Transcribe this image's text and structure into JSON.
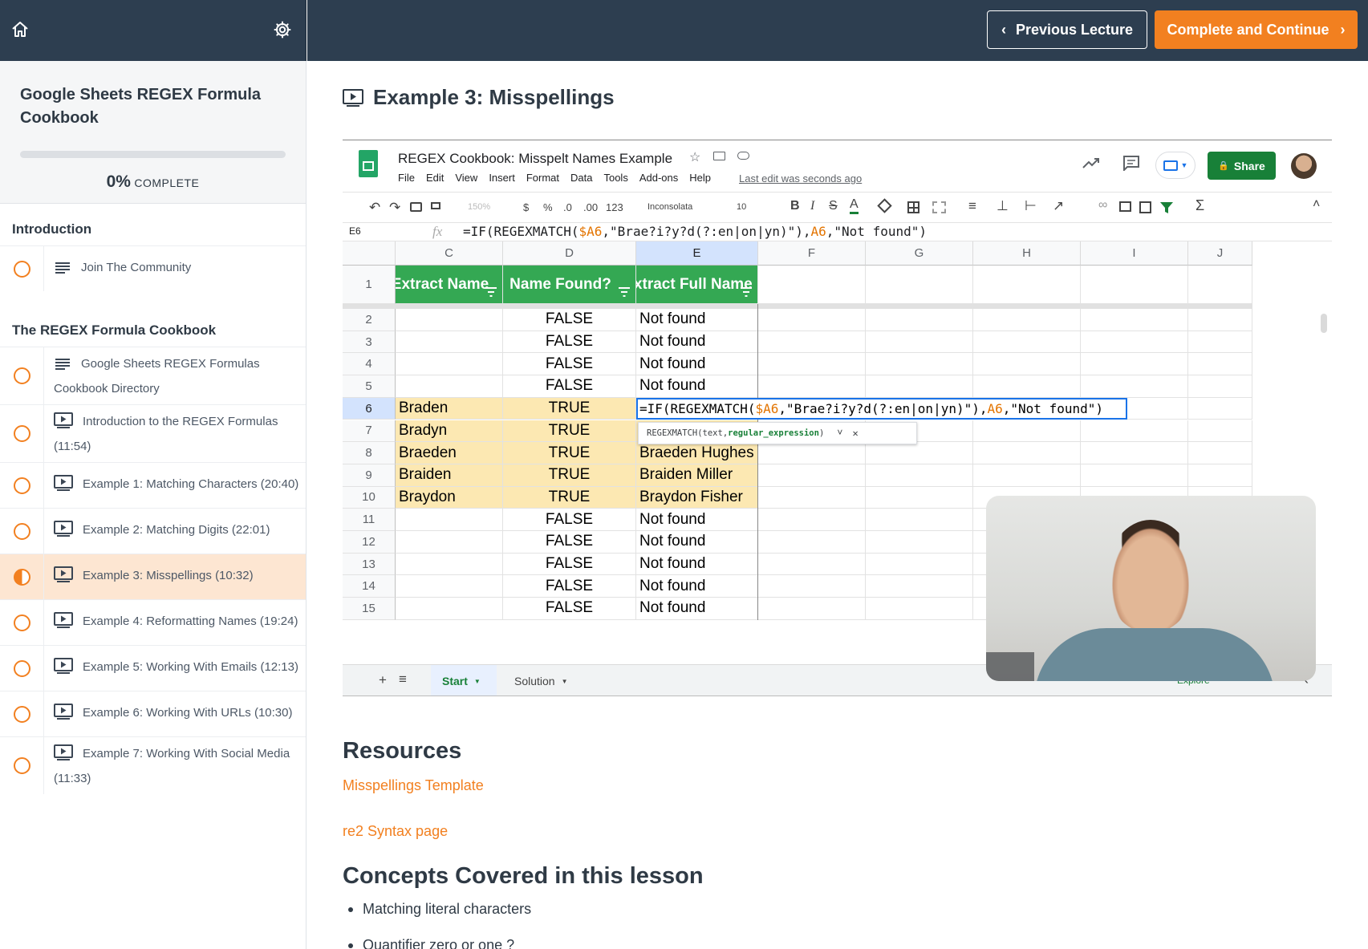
{
  "topbar": {
    "home_icon": "home-icon",
    "settings_icon": "gear-icon",
    "prev_label": "Previous Lecture",
    "next_label": "Complete and Continue",
    "accent": "#f28020",
    "bar_color": "#2d3e50"
  },
  "sidebar": {
    "course_title": "Google Sheets REGEX Formula Cookbook",
    "progress_percent": "0%",
    "progress_suffix": "COMPLETE",
    "progress_fraction": 0,
    "sections": [
      {
        "title": "Introduction",
        "items": [
          {
            "label": "Join The Community",
            "icon": "text-lines-icon",
            "status": "not-started"
          }
        ]
      },
      {
        "title": "The REGEX Formula Cookbook",
        "items": [
          {
            "label": "Google Sheets REGEX Formulas Cookbook Directory",
            "icon": "text-lines-icon",
            "status": "not-started"
          },
          {
            "label": "Introduction to the REGEX Formulas (11:54)",
            "icon": "video-icon",
            "status": "not-started"
          },
          {
            "label": "Example 1: Matching Characters (20:40)",
            "icon": "video-icon",
            "status": "not-started"
          },
          {
            "label": "Example 2: Matching Digits (22:01)",
            "icon": "video-icon",
            "status": "not-started"
          },
          {
            "label": "Example 3: Misspellings (10:32)",
            "icon": "video-icon",
            "status": "in-progress"
          },
          {
            "label": "Example 4: Reformatting Names (19:24)",
            "icon": "video-icon",
            "status": "not-started"
          },
          {
            "label": "Example 5: Working With Emails (12:13)",
            "icon": "video-icon",
            "status": "not-started"
          },
          {
            "label": "Example 6: Working With URLs (10:30)",
            "icon": "video-icon",
            "status": "not-started"
          },
          {
            "label": "Example 7: Working With Social Media (11:33)",
            "icon": "video-icon",
            "status": "not-started"
          }
        ]
      }
    ]
  },
  "lesson": {
    "title": "Example 3: Misspellings",
    "icon": "video-icon"
  },
  "sheet": {
    "doc_title": "REGEX Cookbook: Misspelt Names Example",
    "menus": [
      "File",
      "Edit",
      "View",
      "Insert",
      "Format",
      "Data",
      "Tools",
      "Add-ons",
      "Help"
    ],
    "last_edit": "Last edit was seconds ago",
    "share_label": "Share",
    "toolbar": {
      "zoom": "150%",
      "currency": "$",
      "percent": "%",
      "dec_less": ".0",
      "dec_more": ".00",
      "format_more": "123",
      "font": "Inconsolata",
      "size": "10"
    },
    "name_box": "E6",
    "fx": "fx",
    "formula": "=IF(REGEXMATCH($A6,\"Brae?i?y?d(?:en|on|yn)\"),A6,\"Not found\")",
    "formula_parts": [
      "=IF(REGEXMATCH(",
      "$A6",
      ",\"Brae?i?y?d(?:en|on|yn)\"),",
      "A6",
      ",\"Not found\")"
    ],
    "tooltip": {
      "fn": "REGEXMATCH(text, ",
      "arg": "regular_expression",
      "close": ")"
    },
    "columns": [
      "C",
      "D",
      "E",
      "F",
      "G",
      "H",
      "I",
      "J"
    ],
    "headers": [
      "Extract Name",
      "Name Found?",
      "Extract Full Name"
    ],
    "rows": [
      {
        "n": "1"
      },
      {
        "n": "2",
        "c": "",
        "d": "FALSE",
        "e": "Not found"
      },
      {
        "n": "3",
        "c": "",
        "d": "FALSE",
        "e": "Not found"
      },
      {
        "n": "4",
        "c": "",
        "d": "FALSE",
        "e": "Not found"
      },
      {
        "n": "5",
        "c": "",
        "d": "FALSE",
        "e": "Not found"
      },
      {
        "n": "6",
        "c": "Braden",
        "d": "TRUE",
        "e": ""
      },
      {
        "n": "7",
        "c": "Bradyn",
        "d": "TRUE",
        "e": ""
      },
      {
        "n": "8",
        "c": "Braeden",
        "d": "TRUE",
        "e": "Braeden Hughes"
      },
      {
        "n": "9",
        "c": "Braiden",
        "d": "TRUE",
        "e": "Braiden Miller"
      },
      {
        "n": "10",
        "c": "Braydon",
        "d": "TRUE",
        "e": "Braydon Fisher"
      },
      {
        "n": "11",
        "c": "",
        "d": "FALSE",
        "e": "Not found"
      },
      {
        "n": "12",
        "c": "",
        "d": "FALSE",
        "e": "Not found"
      },
      {
        "n": "13",
        "c": "",
        "d": "FALSE",
        "e": "Not found"
      },
      {
        "n": "14",
        "c": "",
        "d": "FALSE",
        "e": "Not found"
      },
      {
        "n": "15",
        "c": "",
        "d": "FALSE",
        "e": "Not found"
      }
    ],
    "tabs": [
      "Start",
      "Solution"
    ],
    "explore": "Explore",
    "colors": {
      "header_green": "#34a853",
      "match_fill": "#fce8b2",
      "share_green": "#188038"
    }
  },
  "resources": {
    "title": "Resources",
    "links": [
      "Misspellings Template",
      "re2 Syntax page"
    ]
  },
  "concepts": {
    "title": "Concepts Covered in this lesson",
    "items": [
      "Matching literal characters",
      "Quantifier zero or one ?"
    ]
  }
}
